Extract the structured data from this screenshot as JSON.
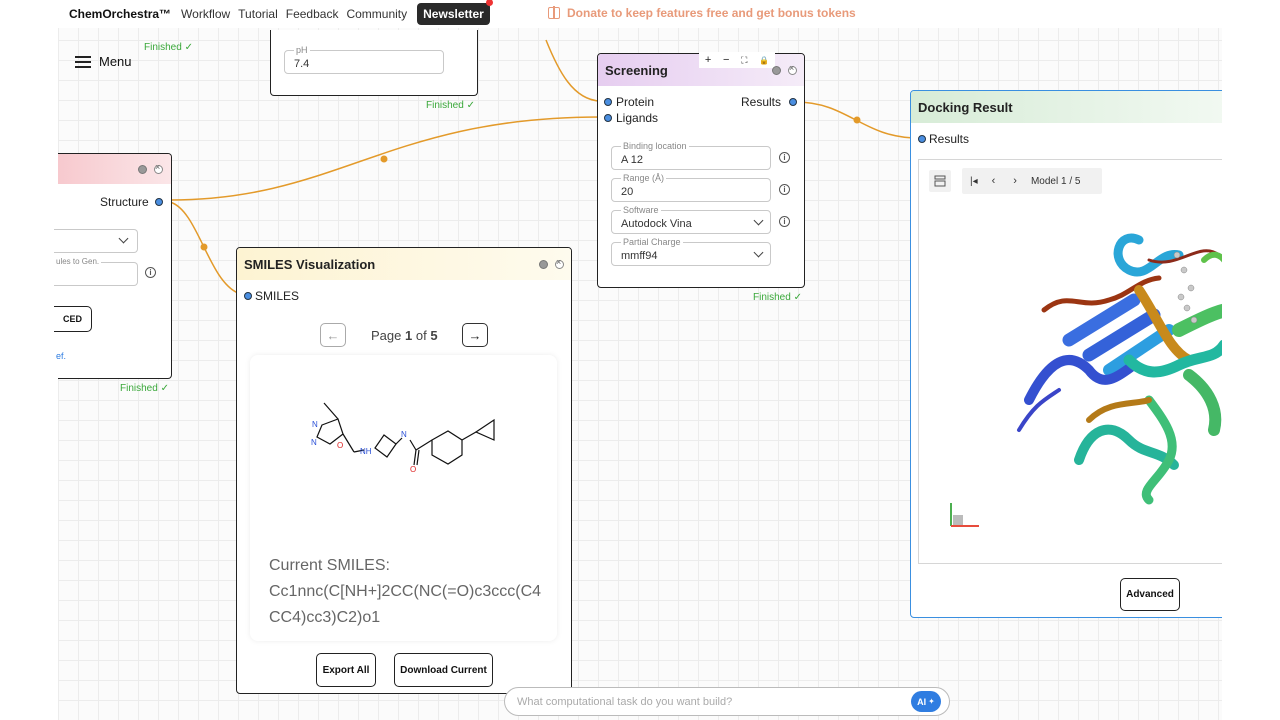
{
  "nav": {
    "brand": "ChemOrchestra™",
    "links": [
      "Workflow",
      "Tutorial",
      "Feedback",
      "Community"
    ],
    "newsletter": "Newsletter",
    "donate": "Donate to keep features free and get bonus tokens"
  },
  "menu": {
    "label": "Menu"
  },
  "finished_label": "Finished ✓",
  "ph_node": {
    "field_label": "pH",
    "field_value": "7.4"
  },
  "gen_node": {
    "output_port": "Structure",
    "field_label_partial": "ules to Gen.",
    "button_partial": "CED",
    "link_partial": "ef."
  },
  "screening": {
    "title": "Screening",
    "toolbar": [
      "+",
      "−",
      "⛶",
      "🔒"
    ],
    "inputs": [
      "Protein",
      "Ligands"
    ],
    "output": "Results",
    "fields": [
      {
        "label": "Binding location",
        "value": "A 12",
        "type": "text"
      },
      {
        "label": "Range (Å)",
        "value": "20",
        "type": "text"
      },
      {
        "label": "Software",
        "value": "Autodock Vina",
        "type": "select"
      },
      {
        "label": "Partial Charge",
        "value": "mmff94",
        "type": "select"
      }
    ]
  },
  "smiles_node": {
    "title": "SMILES Visualization",
    "input": "SMILES",
    "page_prefix": "Page",
    "page_current": "1",
    "page_of": "of",
    "page_total": "5",
    "current_label": "Current SMILES:",
    "smiles": "Cc1nnc(C[NH+]2CC(NC(=O)c3ccc(C4CC4)cc3)C2)o1",
    "buttons": {
      "export_all": "Export All",
      "download_current": "Download Current"
    }
  },
  "docking": {
    "title": "Docking Result",
    "input": "Results",
    "model_label": "Model 1 / 5",
    "advanced": "Advanced"
  },
  "chat": {
    "placeholder": "What computational task do you want build?",
    "ai_label": "AI"
  },
  "colors": {
    "edge": "#e39a2a",
    "port": "#4a8ee0",
    "finished": "#3aa83a",
    "screening_header": "#ecd9f2",
    "smiles_header": "#fdf6dc",
    "docking_header": "#dcefdc",
    "gen_header": "#f9d9dc",
    "ai_button": "#2f7de1"
  }
}
